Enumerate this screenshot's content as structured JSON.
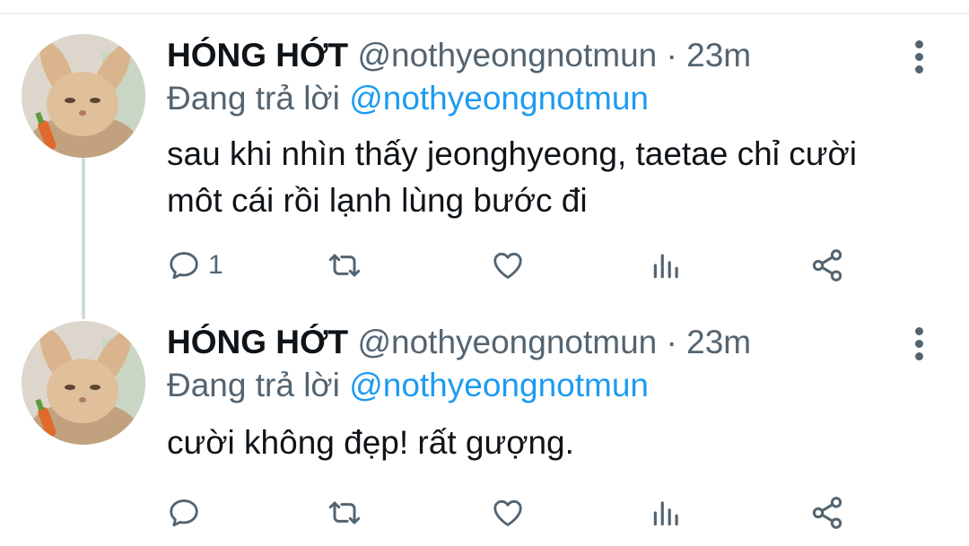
{
  "tweets": [
    {
      "author": "HÓNG HỚT",
      "handle": "@nothyeongnotmun",
      "separator": "·",
      "time": "23m",
      "reply_prefix": "Đang trả lời",
      "reply_to": "@nothyeongnotmun",
      "text_lines": [
        "sau khi nhìn thấy jeonghyeong, taetae chỉ cười",
        "môt cái rồi lạnh lùng bước đi"
      ],
      "reply_count": "1",
      "icons": {
        "reply": "reply-icon",
        "retweet": "retweet-icon",
        "like": "heart-icon",
        "views": "analytics-icon",
        "share": "share-icon"
      }
    },
    {
      "author": "HÓNG HỚT",
      "handle": "@nothyeongnotmun",
      "separator": "·",
      "time": "23m",
      "reply_prefix": "Đang trả lời",
      "reply_to": "@nothyeongnotmun",
      "text_lines": [
        "cười không đẹp! rất gượng."
      ],
      "reply_count": "",
      "icons": {
        "reply": "reply-icon",
        "retweet": "retweet-icon",
        "like": "heart-icon",
        "views": "analytics-icon",
        "share": "share-icon"
      }
    }
  ],
  "colors": {
    "link": "#1d9bf0",
    "secondary": "#536471",
    "thread_line": "#cfd9de"
  }
}
